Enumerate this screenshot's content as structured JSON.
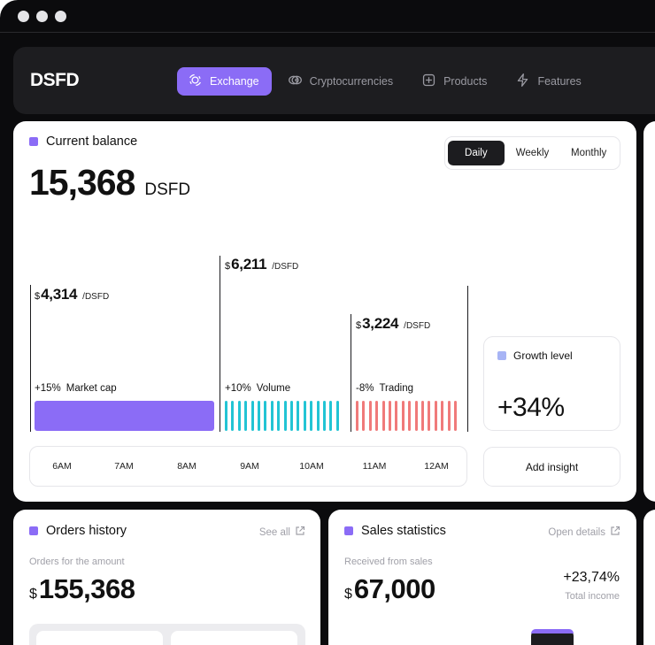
{
  "brand": "DSFD",
  "nav": [
    {
      "label": "Exchange",
      "icon": "exchange-icon",
      "active": true
    },
    {
      "label": "Cryptocurrencies",
      "icon": "coins-icon",
      "active": false
    },
    {
      "label": "Products",
      "icon": "grid-icon",
      "active": false
    },
    {
      "label": "Features",
      "icon": "bolt-icon",
      "active": false
    }
  ],
  "balance": {
    "title": "Current balance",
    "value": "15,368",
    "unit": "DSFD",
    "periods": [
      "Daily",
      "Weekly",
      "Monthly"
    ],
    "active_period": "Daily"
  },
  "metrics": [
    {
      "currency": "$",
      "value": "4,314",
      "unit": "/DSFD",
      "change": "+15%",
      "label": "Market cap",
      "color": "#8b6cf6",
      "style": "solid"
    },
    {
      "currency": "$",
      "value": "6,211",
      "unit": "/DSFD",
      "change": "+10%",
      "label": "Volume",
      "color": "#22c4d4",
      "style": "striped"
    },
    {
      "currency": "$",
      "value": "3,224",
      "unit": "/DSFD",
      "change": "-8%",
      "label": "Trading",
      "color": "#f07a7a",
      "style": "striped"
    }
  ],
  "time_axis": [
    "6AM",
    "7AM",
    "8AM",
    "9AM",
    "10AM",
    "11AM",
    "12AM"
  ],
  "growth": {
    "title": "Growth level",
    "value": "+34%",
    "color": "#a7b4f5"
  },
  "insight_button": "Add insight",
  "orders": {
    "title": "Orders history",
    "link": "See all",
    "sub_label": "Orders for the amount",
    "currency": "$",
    "amount": "155,368"
  },
  "sales": {
    "title": "Sales statistics",
    "link": "Open details",
    "sub_label": "Received from sales",
    "currency": "$",
    "amount": "67,000",
    "income_change": "+23,74%",
    "income_label": "Total income"
  },
  "colors": {
    "accent": "#8b6cf6",
    "dark": "#1c1c1f",
    "cyan": "#22c4d4",
    "coral": "#f07a7a"
  }
}
